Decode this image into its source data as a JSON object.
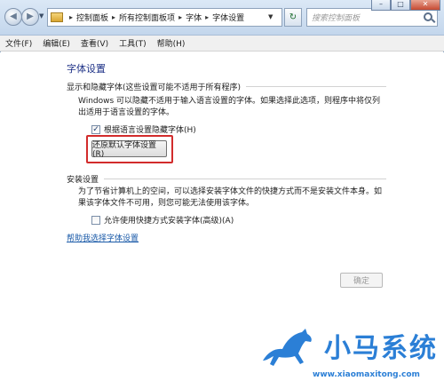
{
  "address": {
    "crumbs": [
      "控制面板",
      "所有控制面板项",
      "字体",
      "字体设置"
    ],
    "search_placeholder": "搜索控制面板"
  },
  "menu": [
    "文件(F)",
    "编辑(E)",
    "查看(V)",
    "工具(T)",
    "帮助(H)"
  ],
  "page": {
    "title": "字体设置",
    "show_hide_group": {
      "heading": "显示和隐藏字体(这些设置可能不适用于所有程序)",
      "description": "Windows 可以隐藏不适用于输入语言设置的字体。如果选择此选项，则程序中将仅列出适用于语言设置的字体。",
      "checkbox_label": "根据语言设置隐藏字体(H)",
      "checkbox_checked": true,
      "restore_button": "还原默认字体设置(R)"
    },
    "install_group": {
      "heading": "安装设置",
      "description": "为了节省计算机上的空间，可以选择安装字体文件的快捷方式而不是安装文件本身。如果该字体文件不可用，则您可能无法使用该字体。",
      "checkbox_label": "允许使用快捷方式安装字体(高级)(A)",
      "checkbox_checked": false
    },
    "help_link": "帮助我选择字体设置",
    "ok_button": "确定"
  },
  "watermark": {
    "title": "小马系统",
    "url": "www.xiaomaxitong.com"
  },
  "colors": {
    "highlight": "#d22c2c",
    "link": "#1a5aa8",
    "title": "#1e3287",
    "watermark": "#2b7fd6"
  }
}
